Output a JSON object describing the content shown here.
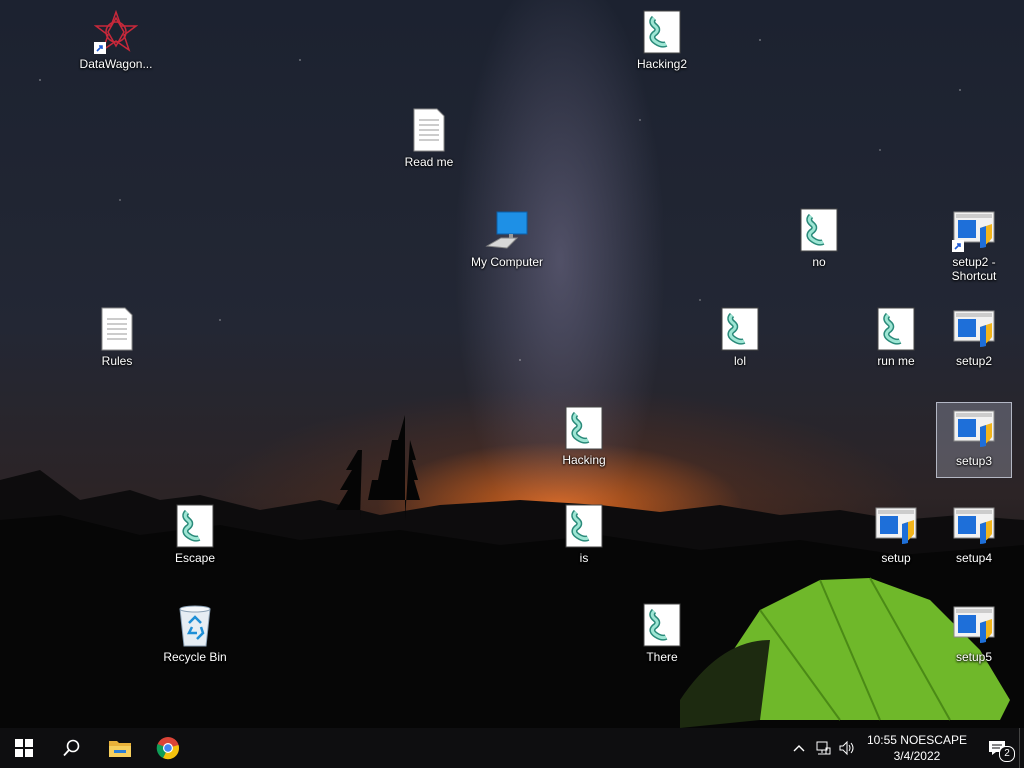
{
  "desktop": {
    "icons": [
      {
        "label": "DataWagon...",
        "type": "logo",
        "shortcut": true
      },
      {
        "label": "Hacking2",
        "type": "script"
      },
      {
        "label": "Read me",
        "type": "text"
      },
      {
        "label": "My Computer",
        "type": "computer"
      },
      {
        "label": "no",
        "type": "script"
      },
      {
        "label": "setup2 - Shortcut",
        "type": "setup",
        "shortcut": true
      },
      {
        "label": "Rules",
        "type": "text"
      },
      {
        "label": "lol",
        "type": "script"
      },
      {
        "label": "run me",
        "type": "script"
      },
      {
        "label": "setup2",
        "type": "setup"
      },
      {
        "label": "Hacking",
        "type": "script"
      },
      {
        "label": "setup3",
        "type": "setup",
        "selected": true
      },
      {
        "label": "Escape",
        "type": "script"
      },
      {
        "label": "is",
        "type": "script"
      },
      {
        "label": "setup",
        "type": "setup"
      },
      {
        "label": "setup4",
        "type": "setup"
      },
      {
        "label": "Recycle Bin",
        "type": "recycle"
      },
      {
        "label": "There",
        "type": "script"
      },
      {
        "label": "setup5",
        "type": "setup"
      }
    ]
  },
  "taskbar": {
    "start_icon": "windows-logo-icon",
    "search_icon": "search-icon",
    "pinned": [
      {
        "name": "file-explorer-icon"
      },
      {
        "name": "chrome-icon"
      }
    ],
    "clock_time": "10:55 NOESCAPE",
    "clock_date": "3/4/2022",
    "notification_count": "2",
    "accent": "#0078d7"
  }
}
